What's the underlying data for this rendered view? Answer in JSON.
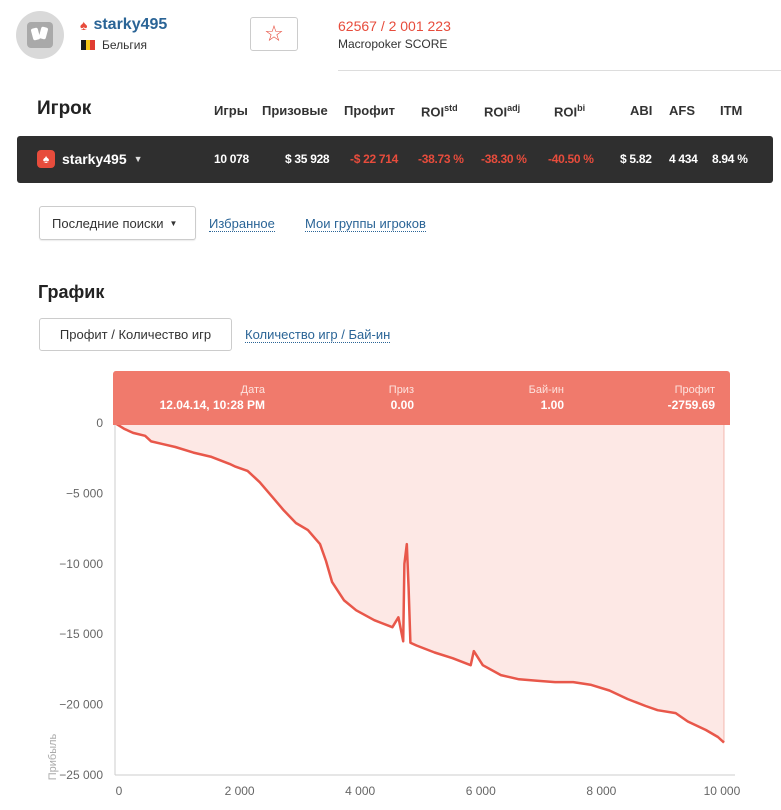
{
  "profile": {
    "username": "starky495",
    "country": "Бельгия",
    "flag_colors": [
      "#1a1a1a",
      "#f5c518",
      "#e03c31"
    ],
    "score": "62567 / 2 001 223",
    "score_label": "Macropoker SCORE",
    "favorite_icon": "star-outline-icon"
  },
  "players": {
    "title": "Игрок",
    "columns": {
      "games": "Игры",
      "prizes": "Призовые",
      "profit": "Профит",
      "roi_std_base": "ROI",
      "roi_std_sup": "std",
      "roi_adj_base": "ROI",
      "roi_adj_sup": "adj",
      "roi_bi_base": "ROI",
      "roi_bi_sup": "bi",
      "abi": "ABI",
      "afs": "AFS",
      "itm": "ITM"
    },
    "row": {
      "name": "starky495",
      "games": "10 078",
      "prizes": "$ 35 928",
      "profit": "-$ 22 714",
      "roi_std": "-38.73 %",
      "roi_adj": "-38.30 %",
      "roi_bi": "-40.50 %",
      "abi": "$ 5.82",
      "afs": "4 434",
      "itm": "8.94 %"
    }
  },
  "filters": {
    "dropdown_label": "Последние поиски",
    "favorites_link": "Избранное",
    "groups_link": "Мои группы игроков"
  },
  "graph": {
    "title": "График",
    "tab_active": "Профит / Количество игр",
    "tab_link": "Количество игр / Бай-ин",
    "tooltip": {
      "date_label": "Дата",
      "date_value": "12.04.14, 10:28 PM",
      "prize_label": "Приз",
      "prize_value": "0.00",
      "buyin_label": "Бай-ин",
      "buyin_value": "1.00",
      "profit_label": "Профит",
      "profit_value": "-2759.69"
    },
    "colors": {
      "line": "#e8574a",
      "fill": "#fde8e5",
      "tooltip": "#f07a6c"
    }
  },
  "chart_data": {
    "type": "area",
    "xlabel": "",
    "ylabel": "Прибыль",
    "xlim": [
      0,
      10200
    ],
    "ylim": [
      -25000,
      3700
    ],
    "x_ticks": [
      0,
      2000,
      4000,
      6000,
      8000,
      10000
    ],
    "x_tick_labels": [
      "0",
      "2 000",
      "4 000",
      "6 000",
      "8 000",
      "10 000"
    ],
    "y_ticks": [
      0,
      -5000,
      -10000,
      -15000,
      -20000,
      -25000
    ],
    "y_tick_labels": [
      "0",
      "−5 000",
      "−10 000",
      "−15 000",
      "−20 000",
      "−25 000"
    ],
    "series": [
      {
        "points": [
          [
            0,
            0
          ],
          [
            150,
            -400
          ],
          [
            300,
            -700
          ],
          [
            500,
            -900
          ],
          [
            600,
            -1300
          ],
          [
            800,
            -1500
          ],
          [
            1000,
            -1700
          ],
          [
            1300,
            -2100
          ],
          [
            1600,
            -2400
          ],
          [
            1900,
            -2900
          ],
          [
            2000,
            -3100
          ],
          [
            2200,
            -3400
          ],
          [
            2400,
            -4200
          ],
          [
            2600,
            -5200
          ],
          [
            2800,
            -6200
          ],
          [
            3000,
            -7100
          ],
          [
            3200,
            -7600
          ],
          [
            3400,
            -8600
          ],
          [
            3500,
            -9800
          ],
          [
            3600,
            -11300
          ],
          [
            3800,
            -12600
          ],
          [
            4000,
            -13300
          ],
          [
            4300,
            -14000
          ],
          [
            4600,
            -14500
          ],
          [
            4700,
            -13800
          ],
          [
            4780,
            -15500
          ],
          [
            4800,
            -10000
          ],
          [
            4840,
            -8600
          ],
          [
            4870,
            -11700
          ],
          [
            4900,
            -15600
          ],
          [
            5000,
            -15800
          ],
          [
            5300,
            -16300
          ],
          [
            5600,
            -16700
          ],
          [
            5900,
            -17200
          ],
          [
            5950,
            -16200
          ],
          [
            6100,
            -17200
          ],
          [
            6400,
            -17900
          ],
          [
            6700,
            -18200
          ],
          [
            7000,
            -18300
          ],
          [
            7300,
            -18400
          ],
          [
            7600,
            -18400
          ],
          [
            7900,
            -18600
          ],
          [
            8200,
            -19000
          ],
          [
            8500,
            -19600
          ],
          [
            8800,
            -20100
          ],
          [
            9000,
            -20400
          ],
          [
            9300,
            -20600
          ],
          [
            9500,
            -21200
          ],
          [
            9800,
            -21800
          ],
          [
            10000,
            -22300
          ],
          [
            10100,
            -22700
          ]
        ]
      }
    ],
    "grid": false
  }
}
